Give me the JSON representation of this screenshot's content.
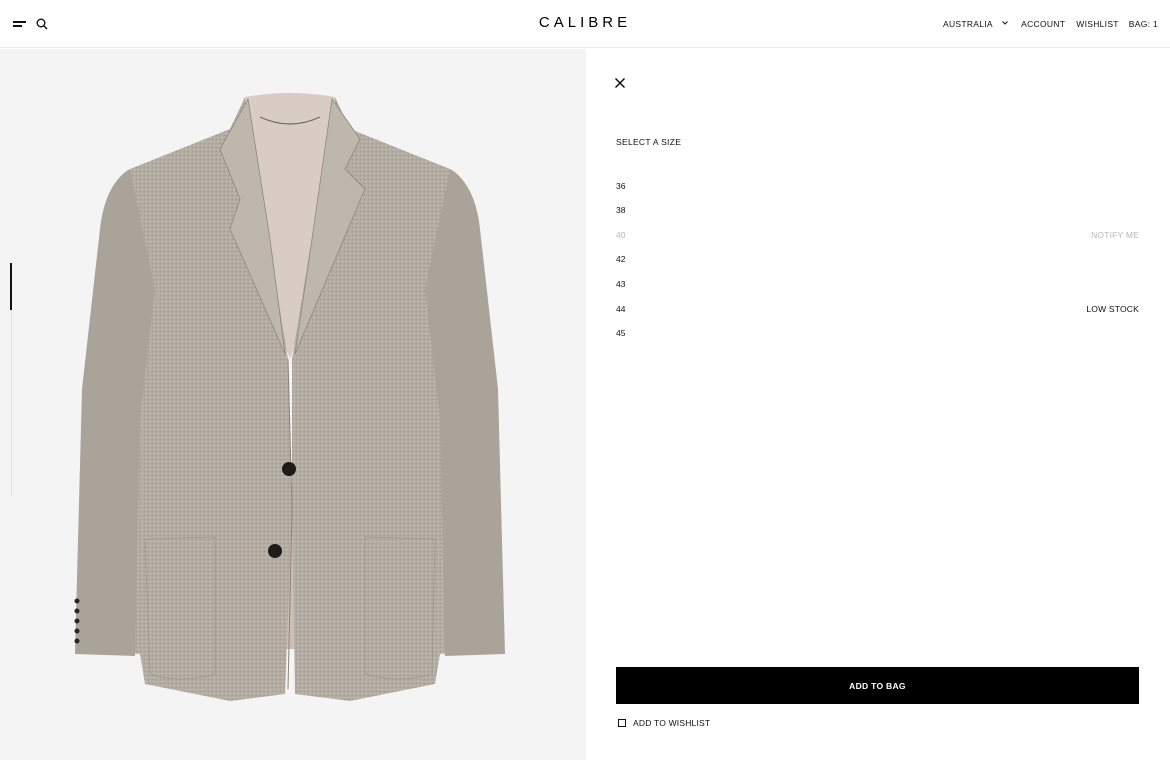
{
  "header": {
    "logo": "CALIBRE",
    "nav": {
      "region": "AUSTRALIA",
      "account": "ACCOUNT",
      "wishlist": "WISHLIST",
      "bag": "BAG: 1"
    },
    "icons": [
      "menu-icon",
      "search-icon",
      "chevron-down-icon"
    ]
  },
  "gallery": {
    "image": "jacket-image",
    "scroll_position": 0.2
  },
  "size_panel": {
    "title": "SELECT A SIZE",
    "sizes": [
      {
        "size": "36",
        "status": "",
        "available": true
      },
      {
        "size": "38",
        "status": "",
        "available": true
      },
      {
        "size": "40",
        "status": "NOTIFY ME",
        "available": false
      },
      {
        "size": "42",
        "status": "",
        "available": true
      },
      {
        "size": "43",
        "status": "",
        "available": true
      },
      {
        "size": "44",
        "status": "LOW STOCK",
        "available": true
      },
      {
        "size": "45",
        "status": "",
        "available": true
      }
    ],
    "add_to_bag": "ADD TO BAG",
    "add_to_wishlist": "ADD TO WISHLIST",
    "colors": {
      "button_bg": "#000000",
      "unavailable_text": "#b8b8b8",
      "gallery_bg": "#f4f4f4"
    }
  }
}
